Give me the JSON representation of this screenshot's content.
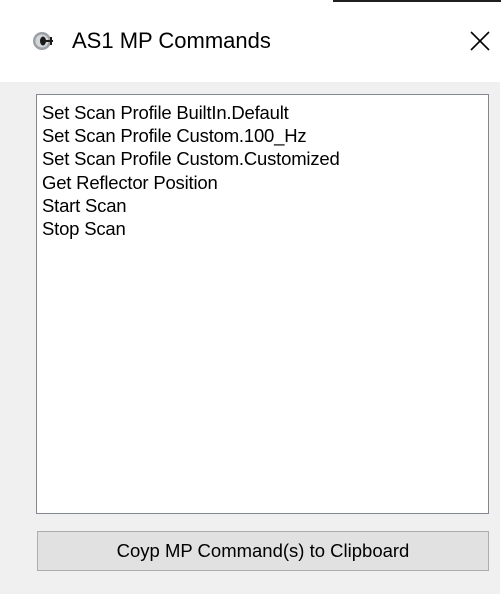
{
  "window": {
    "title": "AS1 MP Commands",
    "icon": "app-icon",
    "close_icon": "close-icon"
  },
  "commands": {
    "items": [
      "Set Scan Profile BuiltIn.Default",
      "Set Scan Profile Custom.100_Hz",
      "Set Scan Profile Custom.Customized",
      "Get Reflector Position",
      "Start Scan",
      "Stop Scan"
    ]
  },
  "actions": {
    "copy_label": "Coyp MP Command(s) to Clipboard"
  },
  "colors": {
    "window_bg": "#f0f0f0",
    "listbox_border": "#828790",
    "button_bg": "#e1e1e1",
    "button_border": "#adadad"
  }
}
